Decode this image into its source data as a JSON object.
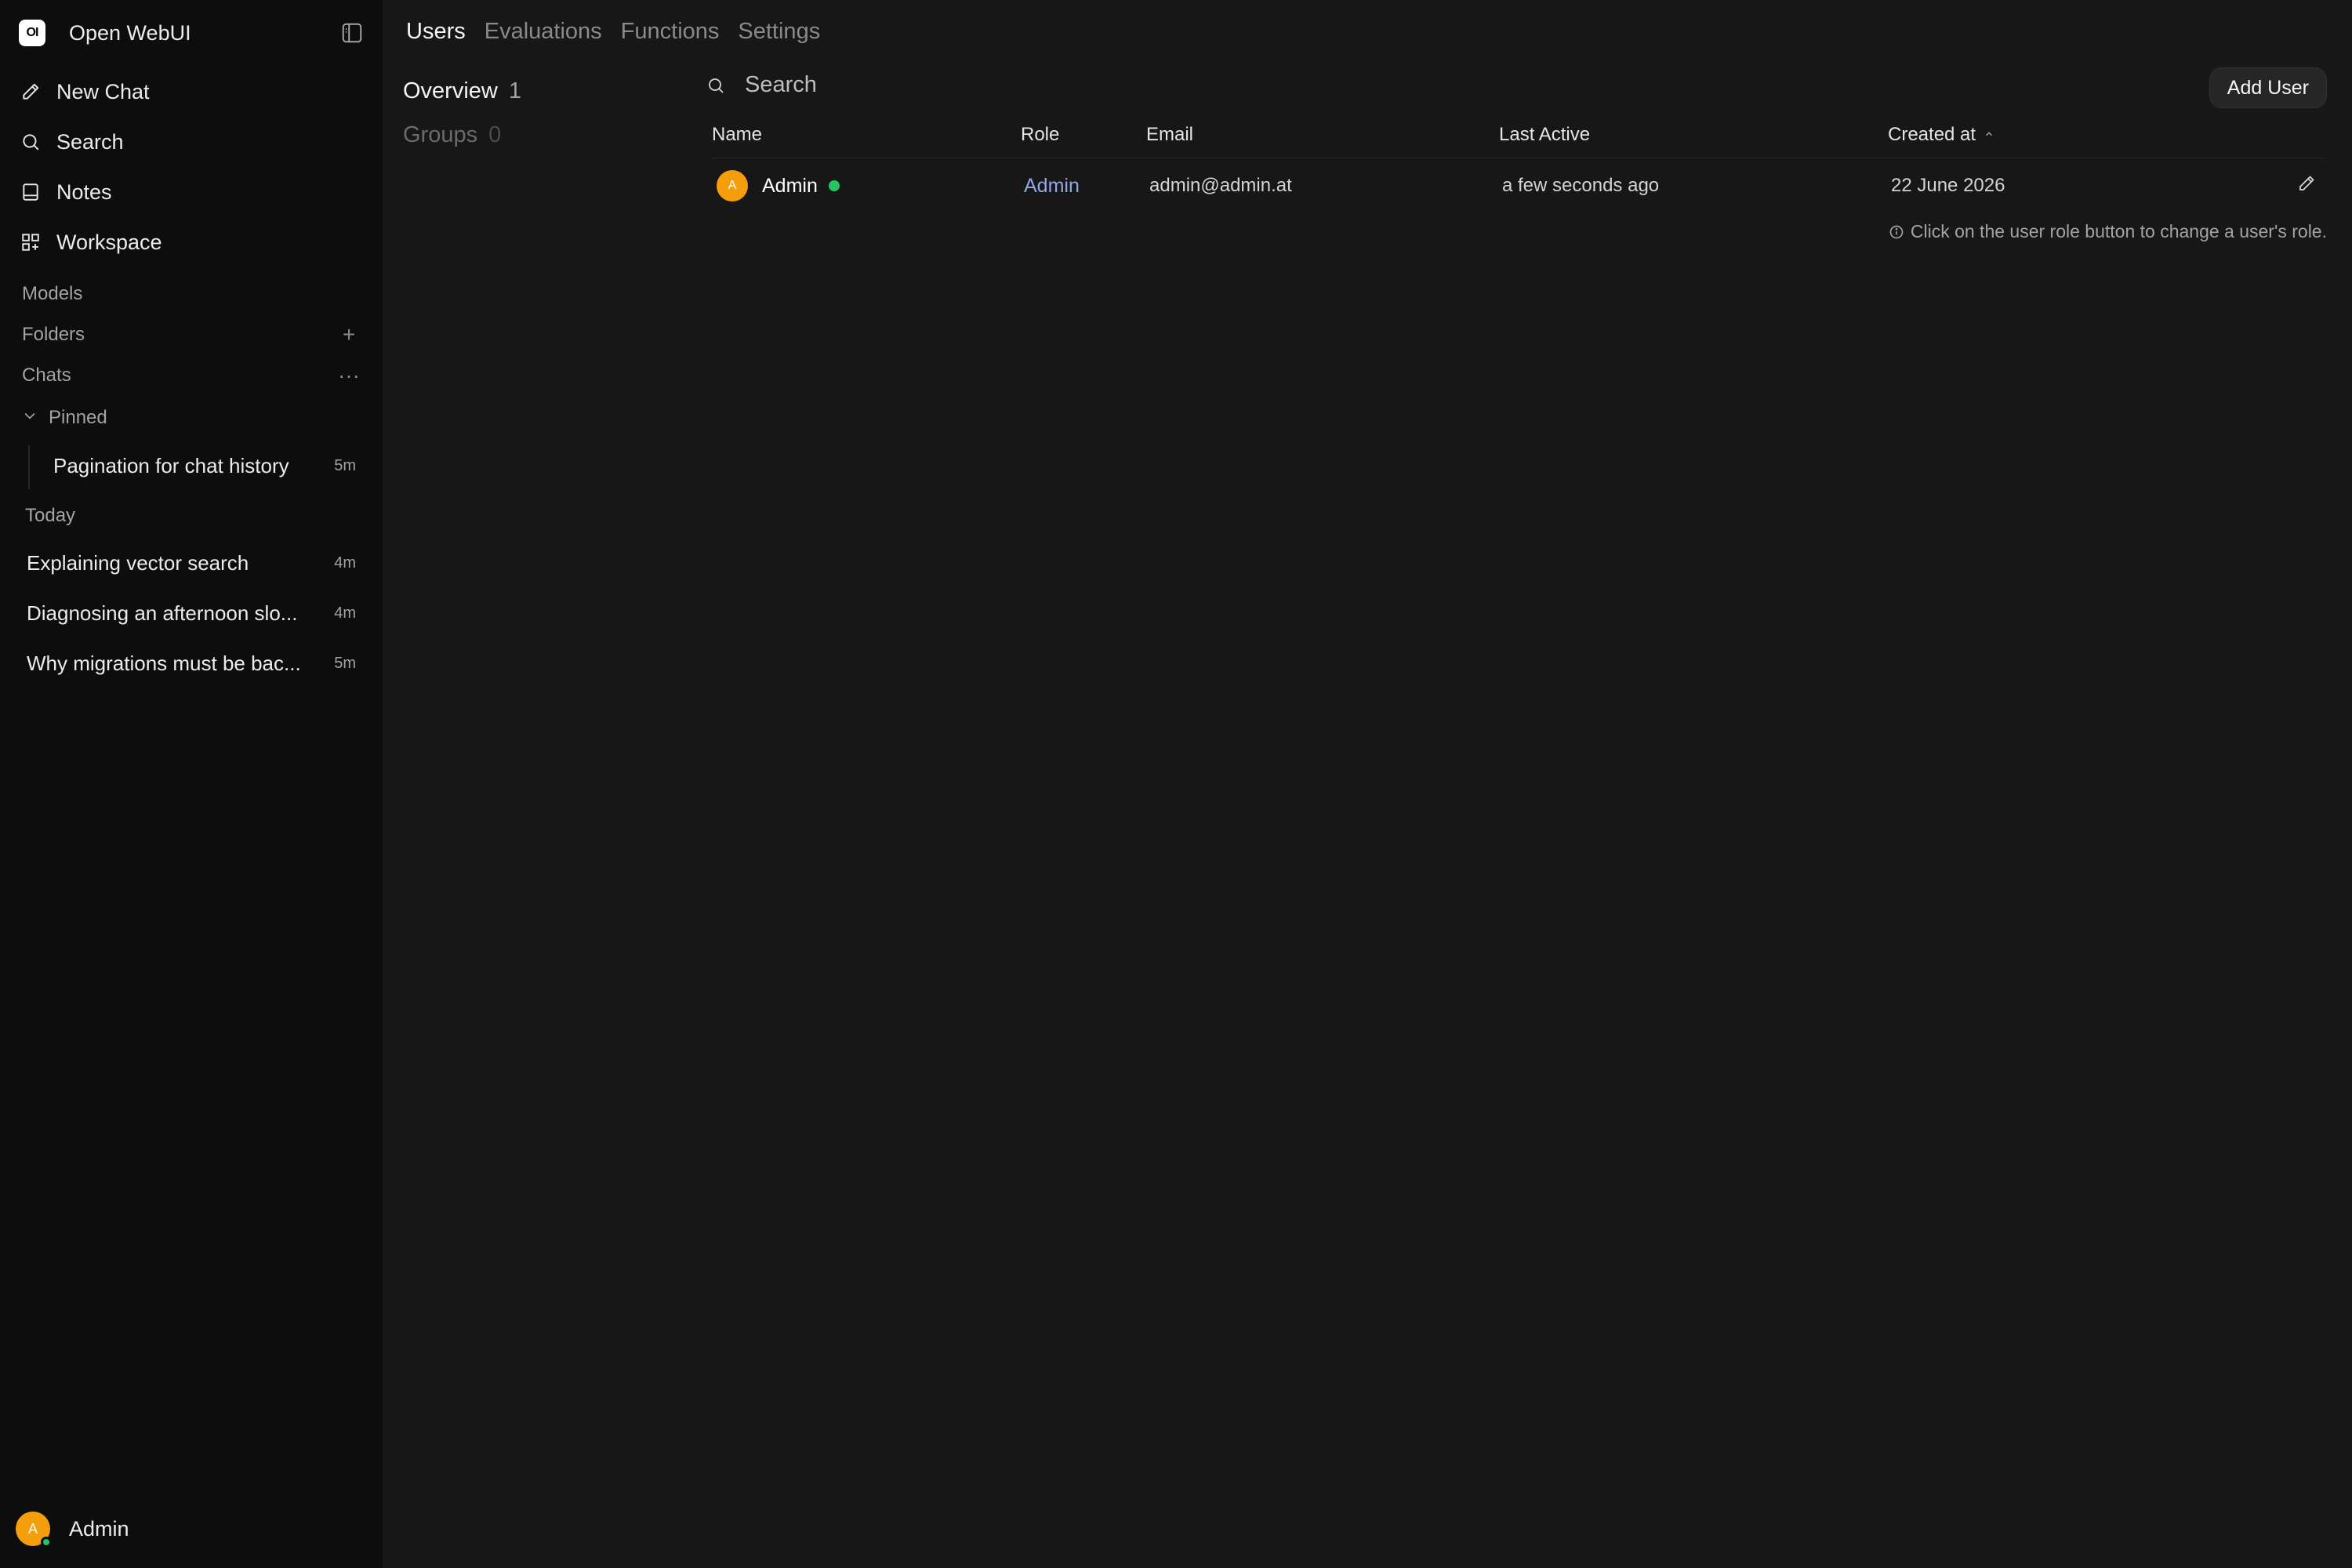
{
  "app": {
    "title": "Open WebUI",
    "logo_text": "OI"
  },
  "sidebar": {
    "nav": [
      {
        "label": "New Chat",
        "icon": "pencil-icon"
      },
      {
        "label": "Search",
        "icon": "search-icon"
      },
      {
        "label": "Notes",
        "icon": "notes-icon"
      },
      {
        "label": "Workspace",
        "icon": "grid-icon"
      }
    ],
    "sections": {
      "models": "Models",
      "folders": "Folders",
      "chats": "Chats"
    },
    "pinned": {
      "label": "Pinned",
      "items": [
        {
          "title": "Pagination for chat history",
          "time": "5m"
        }
      ]
    },
    "today": {
      "label": "Today",
      "items": [
        {
          "title": "Explaining vector search",
          "time": "4m"
        },
        {
          "title": "Diagnosing an afternoon slo...",
          "time": "4m"
        },
        {
          "title": "Why migrations must be bac...",
          "time": "5m"
        }
      ]
    },
    "user": {
      "name": "Admin",
      "initial": "A"
    }
  },
  "tabs": [
    {
      "label": "Users",
      "active": true
    },
    {
      "label": "Evaluations",
      "active": false
    },
    {
      "label": "Functions",
      "active": false
    },
    {
      "label": "Settings",
      "active": false
    }
  ],
  "subnav": [
    {
      "label": "Overview",
      "count": "1",
      "active": true
    },
    {
      "label": "Groups",
      "count": "0",
      "active": false
    }
  ],
  "search": {
    "placeholder": "Search",
    "value": ""
  },
  "add_user_label": "Add User",
  "table": {
    "columns": [
      "Name",
      "Role",
      "Email",
      "Last Active",
      "Created at"
    ],
    "sorted_column": "Created at",
    "sort_direction": "ascending",
    "rows": [
      {
        "initial": "A",
        "name": "Admin",
        "online": true,
        "role": "Admin",
        "email": "admin@admin.at",
        "last_active": "a few seconds ago",
        "created_at": "22 June 2026"
      }
    ]
  },
  "hint": "Click on the user role button to change a user's role.",
  "colors": {
    "background": "#171717",
    "sidebar": "#0d0d0d",
    "avatar": "#f59e0b",
    "online": "#22c55e",
    "role_link": "#93a8e6"
  }
}
